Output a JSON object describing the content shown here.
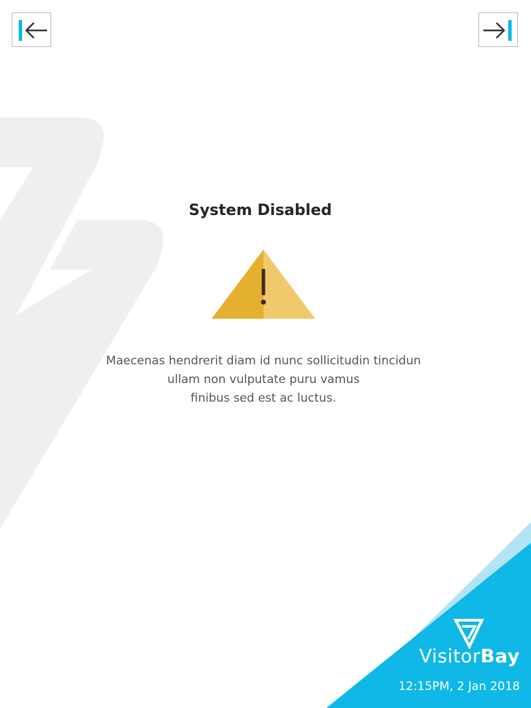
{
  "nav": {
    "prev_icon": "collapse-left-icon",
    "next_icon": "expand-right-icon"
  },
  "status": {
    "title": "System Disabled",
    "icon": "warning-icon",
    "message_lines": [
      "Maecenas hendrerit diam id nunc sollicitudin tincidun",
      "ullam non vulputate puru vamus",
      "finibus sed est ac luctus."
    ]
  },
  "brand": {
    "name_light": "Visitor",
    "name_bold": "Bay",
    "logo_icon": "visitorbay-logo-icon",
    "datetime": "12:15PM, 2 Jan 2018"
  },
  "colors": {
    "accent_blue": "#0fb8e6",
    "accent_blue_light": "#b3e4f3",
    "warning_dark": "#e6b02f",
    "warning_light": "#f0c96c",
    "background_mark": "#efefef",
    "text_dark": "#262626",
    "text_body": "#555555"
  }
}
